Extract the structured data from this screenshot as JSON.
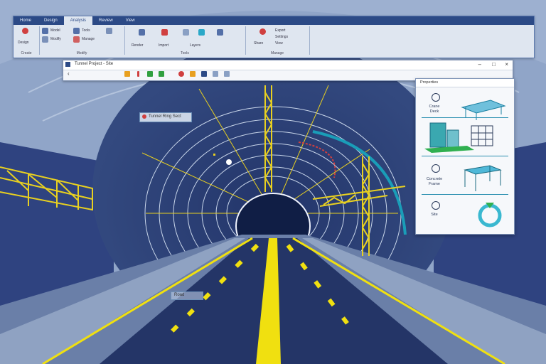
{
  "ribbon": {
    "tabs": [
      "Home",
      "Design",
      "Analysis",
      "Review",
      "View"
    ],
    "groups": [
      {
        "label": "Create"
      },
      {
        "label": "Modify"
      },
      {
        "label": "Tools"
      },
      {
        "label": "Manage"
      }
    ],
    "group_texts": [
      "Design",
      "Model",
      "Modify",
      "Tools",
      "Manage",
      "Render",
      "Import",
      "Layers",
      "Export",
      "Settings",
      "View",
      "Share"
    ]
  },
  "toolbar": {
    "title": "Tunnel Project - Site",
    "minimize": "–",
    "maximize": "□",
    "close": "×"
  },
  "callouts": {
    "top_label": "Tunnel Ring Sect",
    "bottom_label": "Road"
  },
  "panel": {
    "title": "Properties",
    "cards": [
      {
        "label": "Crane Deck"
      },
      {
        "label": "Concrete Frame"
      },
      {
        "label": "Site"
      }
    ]
  },
  "colors": {
    "tunnel_wall": "#2b3f78",
    "ribbon_header": "#2c4a86",
    "road_line": "#f0e010",
    "crane": "#e8d020",
    "accent_teal": "#1a9db8"
  }
}
